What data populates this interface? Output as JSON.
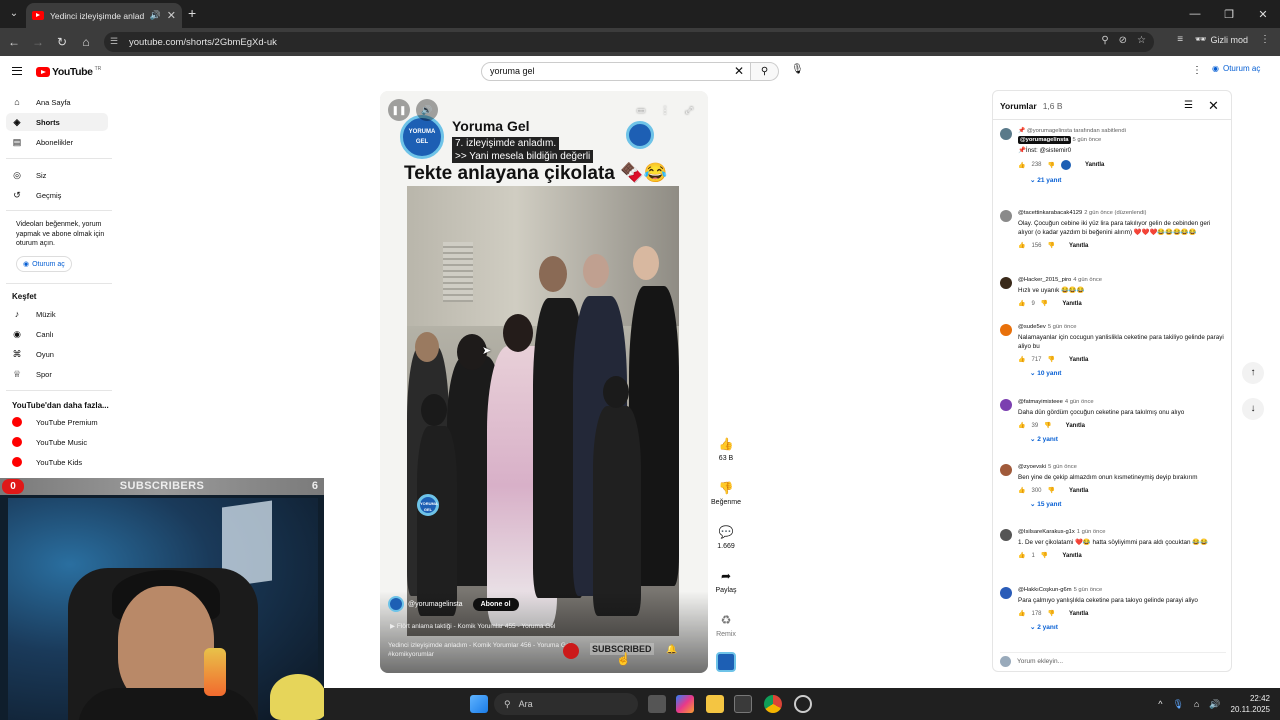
{
  "browser": {
    "tab_title": "Yedinci izleyişimde anladım",
    "url": "youtube.com/shorts/2GbmEgXd-uk",
    "incognito_label": "Gizli mod"
  },
  "masthead": {
    "logo_text": "YouTube",
    "country": "TR",
    "search_value": "yoruma gel",
    "signin_label": "Oturum aç"
  },
  "sidebar": {
    "primary": [
      {
        "label": "Ana Sayfa",
        "icon": "home-icon"
      },
      {
        "label": "Shorts",
        "icon": "shorts-icon"
      },
      {
        "label": "Abonelikler",
        "icon": "subscriptions-icon"
      }
    ],
    "you": [
      {
        "label": "Siz",
        "icon": "you-icon"
      },
      {
        "label": "Geçmiş",
        "icon": "history-icon"
      }
    ],
    "signin_note": "Videoları beğenmek, yorum yapmak ve abone olmak için oturum açın.",
    "signin_label": "Oturum aç",
    "explore_heading": "Keşfet",
    "explore": [
      {
        "label": "Müzik",
        "icon": "music-icon"
      },
      {
        "label": "Canlı",
        "icon": "live-icon"
      },
      {
        "label": "Oyun",
        "icon": "gaming-icon"
      },
      {
        "label": "Spor",
        "icon": "trophy-icon"
      }
    ],
    "more_heading": "YouTube'dan daha fazla...",
    "more": [
      {
        "label": "YouTube Premium"
      },
      {
        "label": "YouTube Music"
      },
      {
        "label": "YouTube Kids"
      }
    ]
  },
  "video": {
    "logo_text": "YORUMA GEL",
    "brand_title": "Yoruma Gel",
    "overlay_line1": "7. izleyişimde anladım.",
    "overlay_line2": ">> Yani mesela bildiğin değerli",
    "headline": "Tekte anlayana çikolata 🍫😂",
    "watermark": "YORUMA GEL",
    "channel_handle": "@yorumagelinsta",
    "subscribe_label": "Abone ol",
    "related_link": "Flört anlama taktiği - Komik Yorumlar 455 - Yoruma Gel",
    "description": "Yedinci izleyişimde anladım - Komik Yorumlar 456 - Yoruma Gel #komikyorumlar",
    "subscribed_overlay": "SUBSCRIBED"
  },
  "actions": {
    "like_count": "63 B",
    "dislike_label": "Beğenme",
    "comment_count": "1.669",
    "share_label": "Paylaş",
    "remix_label": "Remix"
  },
  "comments": {
    "title": "Yorumlar",
    "count": "1,6 B",
    "add_placeholder": "Yorum ekleyin...",
    "items": [
      {
        "pinned_note": "@yorumagelinsta tarafından sabitlendi",
        "author": "@yorumagelinsta",
        "ago": "5 gün önce",
        "text": "📌İnst: @sistemir0",
        "likes": "238",
        "reply": "Yanıtla",
        "replies": "21 yanıt",
        "color": "#5a7a8a"
      },
      {
        "author": "@tacettinkarabacak4129",
        "ago": "2 gün önce (düzenlendi)",
        "text": "Olay. Çocuğun cebine iki yüz lira para takılıyor gelin de cebinden geri alıyor (o kadar yazdım bi beğenini alırım) ❤️❤️❤️😂😂😂😂😂",
        "likes": "156",
        "reply": "Yanıtla",
        "color": "#8a8a8a"
      },
      {
        "author": "@Hacker_2015_piro",
        "ago": "4 gün önce",
        "text": "Hızlı ve uyanık 😂😂😂",
        "likes": "9",
        "reply": "Yanıtla",
        "color": "#3a2a1a"
      },
      {
        "author": "@sude5ev",
        "ago": "5 gün önce",
        "text": "Nalamayanlar için cocugun yanlislikla ceketine para takiliyo gelinde parayi aliyo bu",
        "likes": "717",
        "reply": "Yanıtla",
        "replies": "10 yanıt",
        "color": "#e8700a"
      },
      {
        "author": "@fatmayimisteee",
        "ago": "4 gün önce",
        "text": "Daha dün gördüm çocuğun ceketine para takılmış onu alıyo",
        "likes": "39",
        "reply": "Yanıtla",
        "replies": "2 yanıt",
        "color": "#7b3fb0"
      },
      {
        "author": "@zyoevski",
        "ago": "5 gün önce",
        "text": "Ben yine de çekip almazdım onun kısmetineymiş deyip bırakırım",
        "likes": "300",
        "reply": "Yanıtla",
        "replies": "15 yanıt",
        "color": "#a05a3a"
      },
      {
        "author": "@IsilsareKarakus-g1x",
        "ago": "1 gün önce",
        "text": "1. De ver çikolatami ❤️😂 hatta söyliyimmi para aldı çocuktan 😂😂",
        "likes": "1",
        "reply": "Yanıtla",
        "color": "#555555"
      },
      {
        "author": "@HakkıCoşkun-g6m",
        "ago": "5 gün önce",
        "text": "Para çalmıyo yanlışlıkla ceketine para takıyo gelinde parayi aliyo",
        "likes": "178",
        "reply": "Yanıtla",
        "replies": "2 yanıt",
        "color": "#2a5cb8"
      }
    ]
  },
  "webcam": {
    "badge_count": "0",
    "bar_label": "SUBSCRIBERS",
    "bar_count": "6"
  },
  "taskbar": {
    "search_placeholder": "Ara",
    "time": "22:42",
    "date": "20.11.2025"
  }
}
